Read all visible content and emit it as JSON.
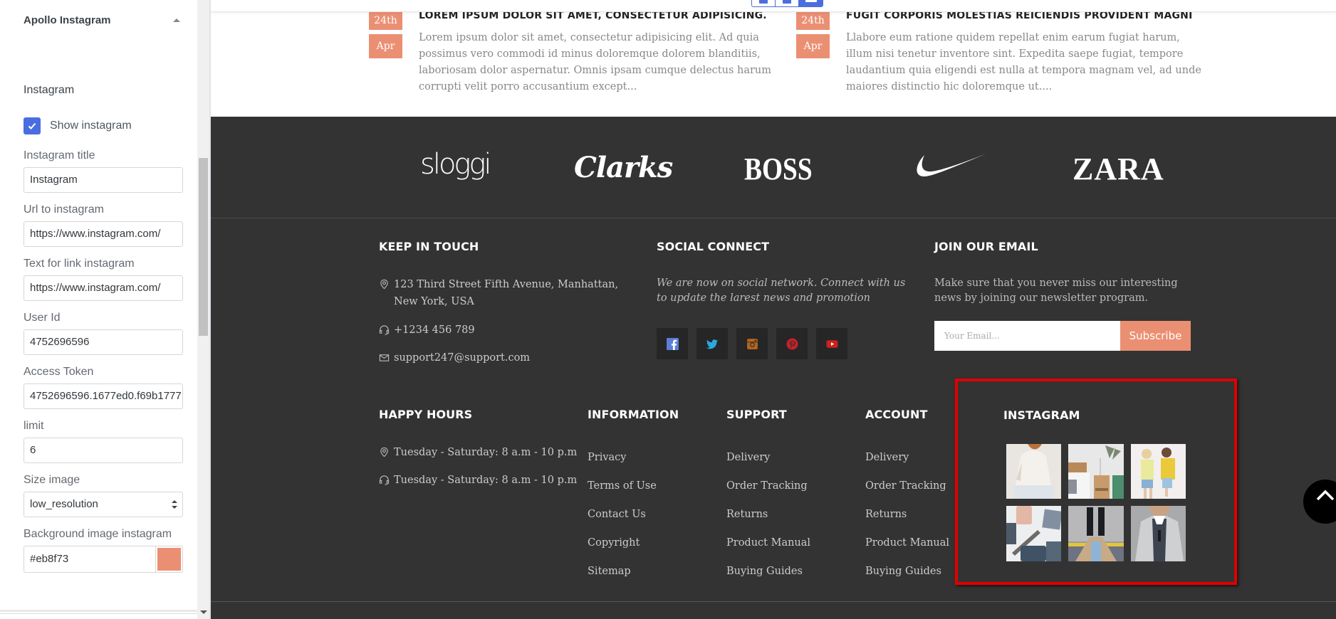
{
  "panel": {
    "title": "Apollo Instagram",
    "section_title": "Instagram",
    "show_instagram": {
      "label": "Show instagram",
      "checked": true
    },
    "fields": {
      "instagram_title": {
        "label": "Instagram title",
        "value": "Instagram"
      },
      "url_to_instagram": {
        "label": "Url to instagram",
        "value": "https://www.instagram.com/"
      },
      "text_for_link": {
        "label": "Text for link instagram",
        "value": "https://www.instagram.com/"
      },
      "user_id": {
        "label": "User Id",
        "value": "4752696596"
      },
      "access_token": {
        "label": "Access Token",
        "value": "4752696596.1677ed0.f69b1777"
      },
      "limit": {
        "label": "limit",
        "value": "6"
      },
      "size_image": {
        "label": "Size image",
        "value": "low_resolution"
      },
      "background": {
        "label": "Background image instagram",
        "value": "#eb8f73",
        "swatch": "#eb8f73"
      }
    }
  },
  "preview": {
    "device_buttons": [
      "mobile-icon",
      "tablet-icon",
      "desktop-icon"
    ],
    "posts": [
      {
        "day": "24th",
        "month": "Apr",
        "title": "LOREM IPSUM DOLOR SIT AMET, CONSECTETUR ADIPISICING.",
        "excerpt": "Lorem ipsum dolor sit amet, consectetur adipisicing elit. Ad quia possimus vero commodi id minus doloremque dolorem blanditiis, laboriosam dolor aspernatur. Omnis ipsam cumque delectus harum corrupti velit porro accusantium except..."
      },
      {
        "day": "24th",
        "month": "Apr",
        "title": "FUGIT CORPORIS MOLESTIAS REICIENDIS PROVIDENT MAGNI",
        "excerpt": "Llabore eum ratione quidem repellat enim earum fugiat harum, illum nisi tenetur inventore sint. Expedita saepe fugiat, tempore laudantium quia eligendi est nulla at tempora magnam vel, ad unde maiores distinctio hic doloremque ut...."
      }
    ],
    "brands": [
      "sloggi",
      "Clarks",
      "BOSS",
      "Nike",
      "ZARA"
    ],
    "keep_in_touch": {
      "title": "KEEP IN TOUCH",
      "address": "123 Third Street Fifth Avenue, Manhattan, New York, USA",
      "phone": "+1234 456 789",
      "email": "support247@support.com"
    },
    "social_connect": {
      "title": "SOCIAL CONNECT",
      "description": "We are now on social network. Connect with us to update the larest news and promotion",
      "networks": [
        {
          "name": "facebook",
          "color": "#5b7fd6"
        },
        {
          "name": "twitter",
          "color": "#2aa9e0"
        },
        {
          "name": "instagram",
          "color": "#b5651d"
        },
        {
          "name": "pinterest",
          "color": "#cb2027"
        },
        {
          "name": "youtube",
          "color": "#cd201f"
        }
      ]
    },
    "join_email": {
      "title": "JOIN OUR EMAIL",
      "description": "Make sure that you never miss our interesting news by joining our newsletter program.",
      "placeholder": "Your Email...",
      "button": "Subscribe"
    },
    "happy_hours": {
      "title": "HAPPY HOURS",
      "lines": [
        "Tuesday - Saturday: 8 a.m - 10 p.m",
        "Tuesday - Saturday: 8 a.m - 10 p.m"
      ]
    },
    "information": {
      "title": "INFORMATION",
      "links": [
        "Privacy",
        "Terms of Use",
        "Contact Us",
        "Copyright",
        "Sitemap"
      ]
    },
    "support": {
      "title": "SUPPORT",
      "links": [
        "Delivery",
        "Order Tracking",
        "Returns",
        "Product Manual",
        "Buying Guides"
      ]
    },
    "account": {
      "title": "ACCOUNT",
      "links": [
        "Delivery",
        "Order Tracking",
        "Returns",
        "Product Manual",
        "Buying Guides"
      ]
    },
    "instagram": {
      "title": "INSTAGRAM",
      "images": [
        "woman-white-sweater",
        "bedroom-nightstand",
        "two-girls-yellow",
        "flatlay-accessories",
        "legs-black-boots",
        "man-grey-blazer"
      ]
    },
    "accent_color": "#eb8f73",
    "highlight_color": "#e00000"
  }
}
